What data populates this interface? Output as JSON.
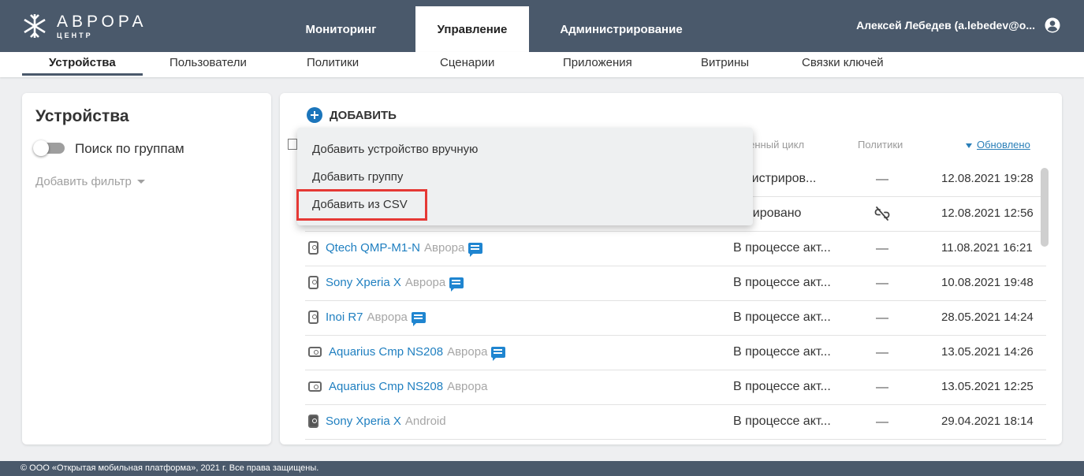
{
  "brand": {
    "title": "АВРОРА",
    "subtitle": "ЦЕНТР",
    "accent": "#4a596b"
  },
  "nav": {
    "tabs": [
      {
        "label": "Мониторинг",
        "active": false
      },
      {
        "label": "Управление",
        "active": true
      },
      {
        "label": "Администрирование",
        "active": false
      }
    ],
    "user": "Алексей Лебедев (a.lebedev@o...",
    "user_icon": "account-circle-icon"
  },
  "subnav": {
    "items": [
      {
        "label": "Устройства",
        "active": true
      },
      {
        "label": "Пользователи",
        "active": false
      },
      {
        "label": "Политики",
        "active": false
      },
      {
        "label": "Сценарии",
        "active": false
      },
      {
        "label": "Приложения",
        "active": false
      },
      {
        "label": "Витрины",
        "active": false
      },
      {
        "label": "Связки ключей",
        "active": false
      }
    ]
  },
  "sidebar": {
    "title": "Устройства",
    "group_search_label": "Поиск по группам",
    "group_search_enabled": false,
    "add_filter_label": "Добавить фильтр"
  },
  "main": {
    "add_label": "ДОБАВИТЬ",
    "columns": {
      "lifecycle": "зненный цикл",
      "policies": "Политики",
      "updated": "Обновлено"
    },
    "rows": [
      {
        "name": "",
        "os": "",
        "lifecycle": "регистриров...",
        "policies": "—",
        "updated": "12.08.2021 19:28"
      },
      {
        "name": "",
        "os": "",
        "lifecycle": "тивировано",
        "policies": "unlink-icon",
        "updated": "12.08.2021 12:56"
      },
      {
        "name": "Qtech QMP-M1-N",
        "os": "Аврора",
        "lifecycle": "В процессе акт...",
        "policies": "—",
        "updated": "11.08.2021 16:21"
      },
      {
        "name": "Sony Xperia X",
        "os": "Аврора",
        "lifecycle": "В процессе акт...",
        "policies": "—",
        "updated": "10.08.2021 19:48"
      },
      {
        "name": "Inoi R7",
        "os": "Аврора",
        "lifecycle": "В процессе акт...",
        "policies": "—",
        "updated": "28.05.2021 14:24"
      },
      {
        "name": "Aquarius Cmp NS208",
        "os": "Аврора",
        "lifecycle": "В процессе акт...",
        "policies": "—",
        "updated": "13.05.2021 14:26"
      },
      {
        "name": "Aquarius Cmp NS208",
        "os": "Аврора",
        "lifecycle": "В процессе акт...",
        "policies": "—",
        "updated": "13.05.2021 12:25"
      },
      {
        "name": "Sony Xperia X",
        "os": "Android",
        "lifecycle": "В процессе акт...",
        "policies": "—",
        "updated": "29.04.2021 18:14"
      }
    ]
  },
  "dropdown": {
    "items": [
      {
        "label": "Добавить устройство вручную"
      },
      {
        "label": "Добавить группу"
      },
      {
        "label": "Добавить из CSV",
        "highlighted": true
      }
    ],
    "highlight_color": "#e53935"
  },
  "footer": {
    "text": "© ООО «Открытая мобильная платформа», 2021 г. Все права защищены."
  }
}
